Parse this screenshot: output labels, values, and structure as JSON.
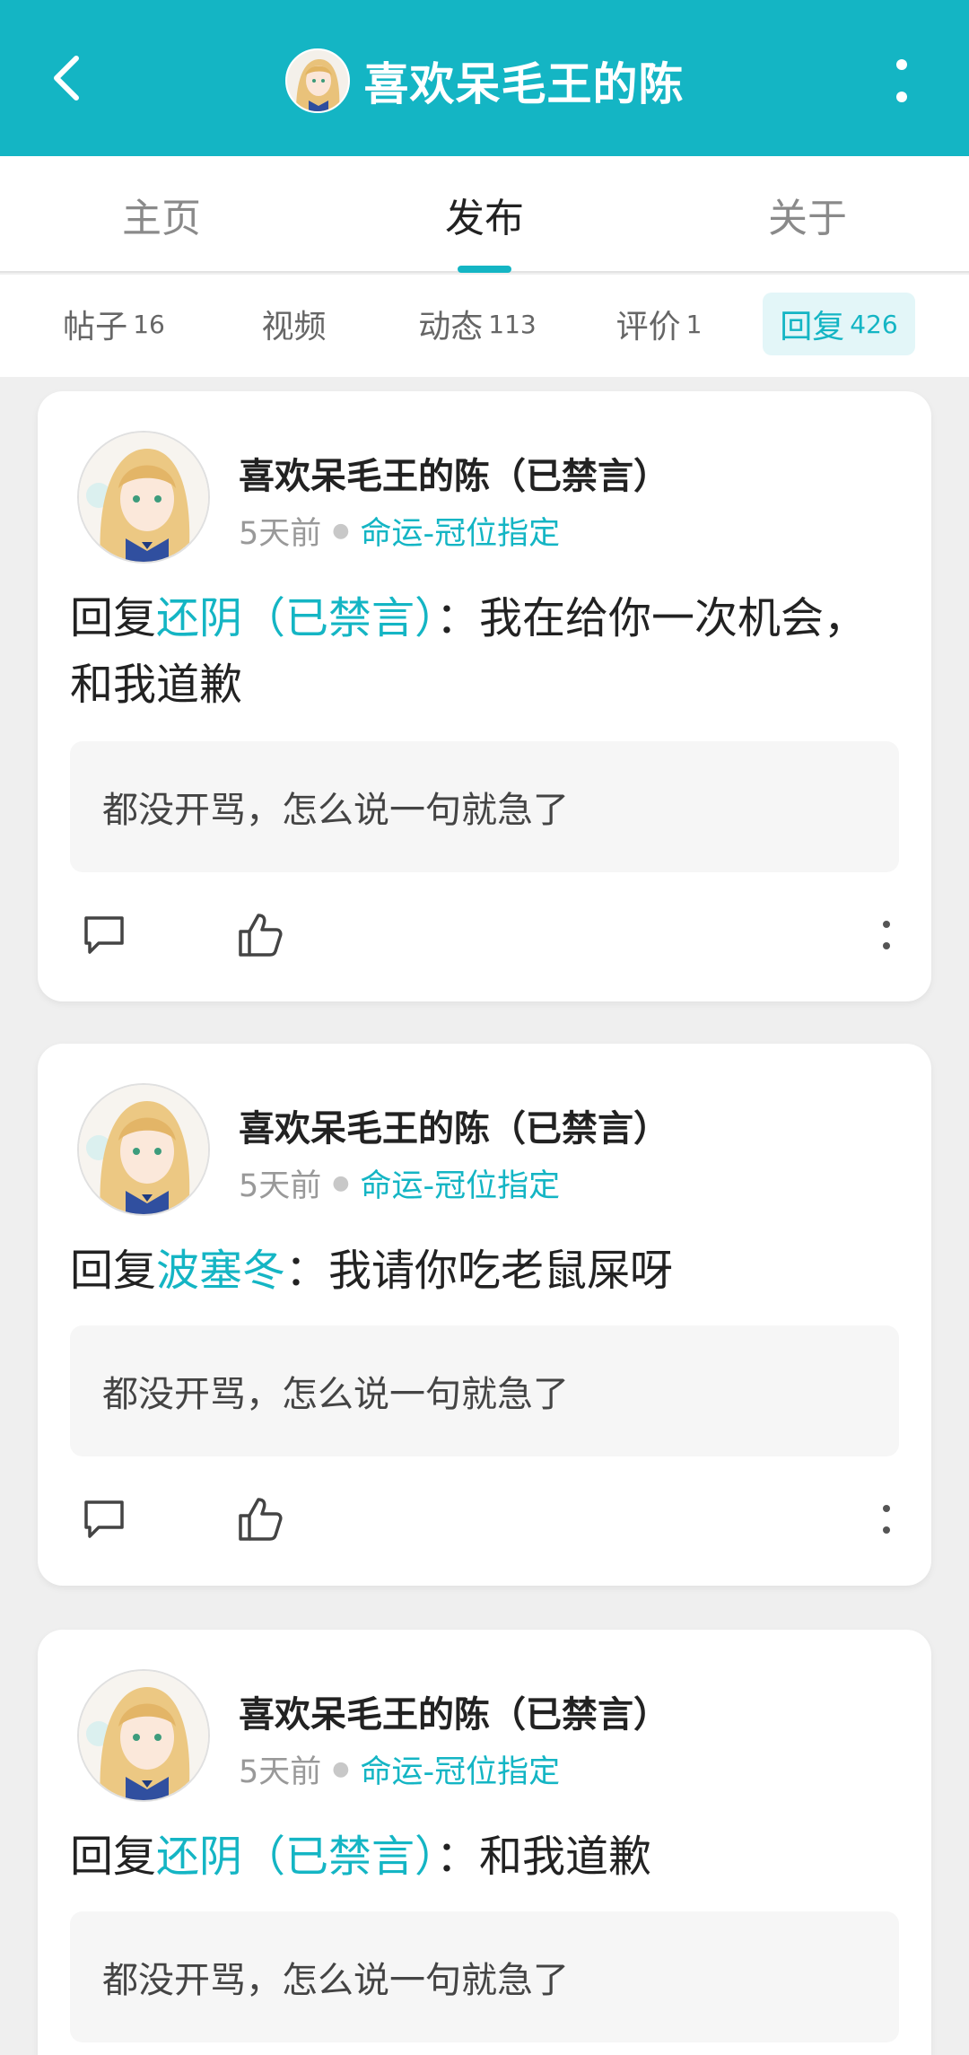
{
  "header": {
    "title": "喜欢呆毛王的陈",
    "back_icon": "back-chevron-icon",
    "more_icon": "more-vertical-icon"
  },
  "tabs": [
    {
      "label": "主页",
      "active": false
    },
    {
      "label": "发布",
      "active": true
    },
    {
      "label": "关于",
      "active": false
    }
  ],
  "subtabs": [
    {
      "label": "帖子",
      "count": "16",
      "active": false
    },
    {
      "label": "视频",
      "count": "",
      "active": false
    },
    {
      "label": "动态",
      "count": "113",
      "active": false
    },
    {
      "label": "评价",
      "count": "1",
      "active": false
    },
    {
      "label": "回复",
      "count": "426",
      "active": true
    }
  ],
  "colors": {
    "accent": "#14b5c4",
    "background": "#efefef"
  },
  "posts": [
    {
      "username": "喜欢呆毛王的陈（已禁言）",
      "time": "5天前",
      "forum": "命运-冠位指定",
      "reply_prefix": "回复",
      "mention": "还阴（已禁言）",
      "reply_sep": "：",
      "reply_text": "我在给你一次机会，和我道歉",
      "quote": "都没开骂，怎么说一句就急了"
    },
    {
      "username": "喜欢呆毛王的陈（已禁言）",
      "time": "5天前",
      "forum": "命运-冠位指定",
      "reply_prefix": "回复",
      "mention": "波塞冬",
      "reply_sep": "：",
      "reply_text": "我请你吃老鼠屎呀",
      "quote": "都没开骂，怎么说一句就急了"
    },
    {
      "username": "喜欢呆毛王的陈（已禁言）",
      "time": "5天前",
      "forum": "命运-冠位指定",
      "reply_prefix": "回复",
      "mention": "还阴（已禁言）",
      "reply_sep": "：",
      "reply_text": "和我道歉",
      "quote": "都没开骂，怎么说一句就急了"
    }
  ]
}
